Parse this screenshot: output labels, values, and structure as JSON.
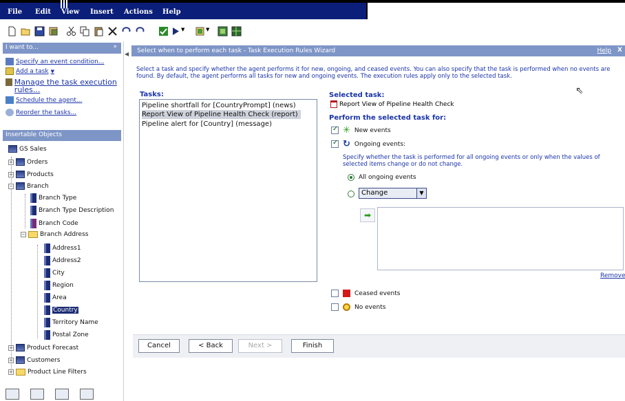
{
  "menu": [
    "File",
    "Edit",
    "View",
    "Insert",
    "Actions",
    "Help"
  ],
  "left": {
    "iwant_header": "I want to...",
    "iwant_items": [
      "Specify an event condition...",
      "Add a task",
      "Manage the task execution rules...",
      "Schedule the agent...",
      "Reorder the tasks..."
    ],
    "insertable_header": "Insertable Objects",
    "tree": {
      "root": "GS Sales",
      "orders": "Orders",
      "products": "Products",
      "branch": "Branch",
      "branch_children": [
        "Branch Type",
        "Branch Type Description",
        "Branch Code"
      ],
      "branch_address": "Branch Address",
      "address_children": [
        "Address1",
        "Address2",
        "City",
        "Region",
        "Area",
        "Country",
        "Territory Name",
        "Postal Zone"
      ],
      "product_forecast": "Product Forecast",
      "customers": "Customers",
      "product_line_filters": "Product Line Filters"
    }
  },
  "wizard": {
    "title": "Select when to perform each task - Task Execution Rules Wizard",
    "help": "Help",
    "close": "X",
    "description": "Select a task and specify whether the agent performs it for new, ongoing, and ceased events. You can also specify that the task is performed when no events are found. By default, the agent performs all tasks for new and ongoing events. The execution rules apply only to the selected task.",
    "tasks_label": "Tasks:",
    "tasks": [
      "Pipeline shortfall for [CountryPrompt] (news)",
      "Report View of Pipeline Health Check (report)",
      "Pipeline alert for [Country] (message)"
    ],
    "selected_index": 1,
    "selected_task_label": "Selected task:",
    "selected_task": "Report View of Pipeline Health Check",
    "perform_label": "Perform the selected task for:",
    "new_events": "New events",
    "ongoing_events": "Ongoing events:",
    "ongoing_desc": "Specify whether the task is performed for all ongoing events or only when the values of selected items change or do not change.",
    "all_ongoing": "All ongoing events",
    "change_value": "Change",
    "remove": "Remove",
    "ceased_events": "Ceased events",
    "no_events": "No events",
    "buttons": {
      "cancel": "Cancel",
      "back": "< Back",
      "next": "Next >",
      "finish": "Finish"
    }
  }
}
